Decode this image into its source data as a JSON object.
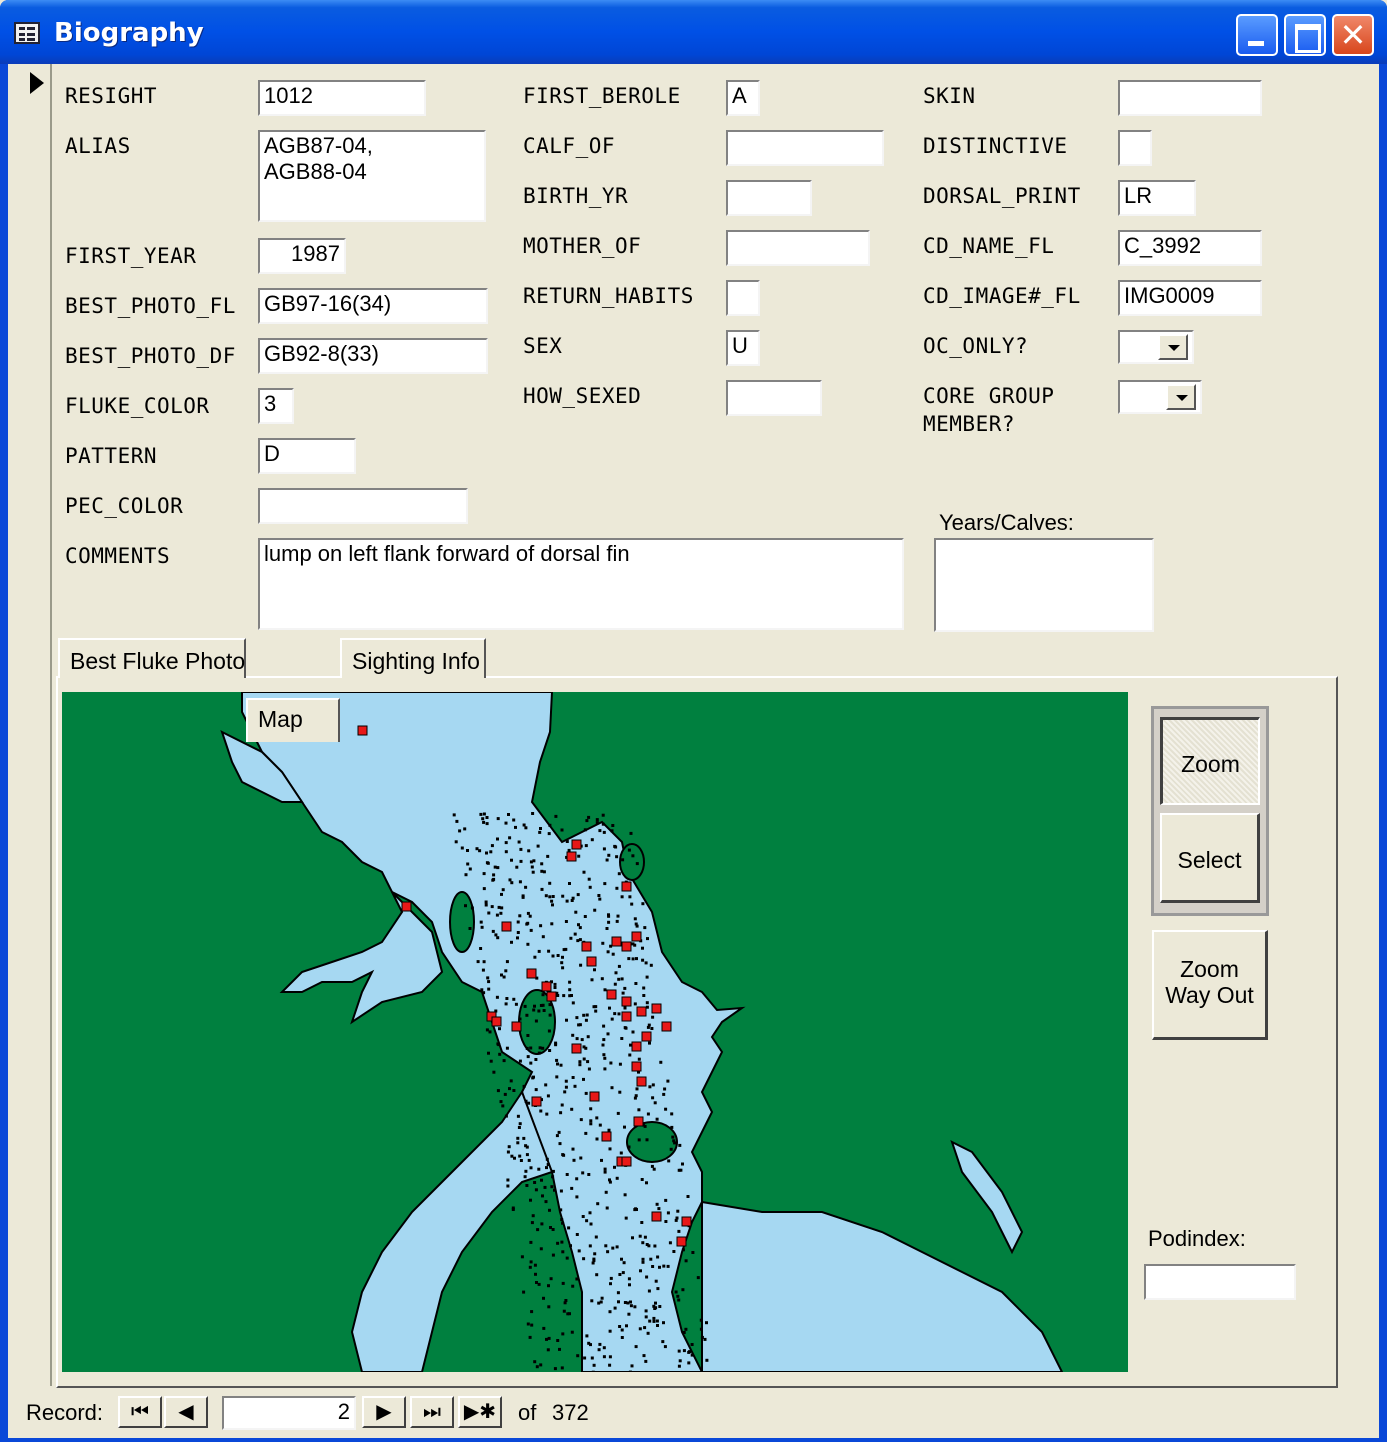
{
  "window": {
    "title": "Biography"
  },
  "fields": {
    "resight_label": "RESIGHT",
    "resight": "1012",
    "alias_label": "ALIAS",
    "alias": "AGB87-04,\nAGB88-04",
    "first_year_label": "FIRST_YEAR",
    "first_year": "1987",
    "best_photo_fl_label": "BEST_PHOTO_FL",
    "best_photo_fl": "GB97-16(34)",
    "best_photo_df_label": "BEST_PHOTO_DF",
    "best_photo_df": "GB92-8(33)",
    "fluke_color_label": "FLUKE_COLOR",
    "fluke_color": "3",
    "pattern_label": "PATTERN",
    "pattern": "D",
    "pec_color_label": "PEC_COLOR",
    "pec_color": "",
    "comments_label": "COMMENTS",
    "comments": "lump on left flank forward of dorsal fin",
    "first_berole_label": "FIRST_BEROLE",
    "first_berole": "A",
    "calf_of_label": "CALF_OF",
    "calf_of": "",
    "birth_yr_label": "BIRTH_YR",
    "birth_yr": "",
    "mother_of_label": "MOTHER_OF",
    "mother_of": "",
    "return_habits_label": "RETURN_HABITS",
    "return_habits": "",
    "sex_label": "SEX",
    "sex": "U",
    "how_sexed_label": "HOW_SEXED",
    "how_sexed": "",
    "skin_label": "SKIN",
    "skin": "",
    "distinctive_label": "DISTINCTIVE",
    "distinctive": "",
    "dorsal_print_label": "DORSAL_PRINT",
    "dorsal_print": "LR",
    "cd_name_fl_label": "CD_NAME_FL",
    "cd_name_fl": "C_3992",
    "cd_image_fl_label": "CD_IMAGE#_FL",
    "cd_image_fl": "IMG0009",
    "oc_only_label": "OC_ONLY?",
    "oc_only": "",
    "core_group_label_1": "CORE GROUP",
    "core_group_label_2": "MEMBER?",
    "core_group": "",
    "years_calves_label": "Years/Calves:",
    "years_calves": "",
    "podindex_label": "Podindex:",
    "podindex": ""
  },
  "tabs": [
    "Best Fluke Photo",
    "Map",
    "Sighting Info"
  ],
  "map_buttons": {
    "zoom": "Zoom",
    "select": "Select",
    "zoom_out_1": "Zoom",
    "zoom_out_2": "Way Out"
  },
  "colors": {
    "land": "#00803f",
    "water": "#a6d8f2",
    "sighting": "#e81818"
  },
  "navigation": {
    "record_label": "Record:",
    "current": "2",
    "of_label": "of",
    "total": "372"
  }
}
